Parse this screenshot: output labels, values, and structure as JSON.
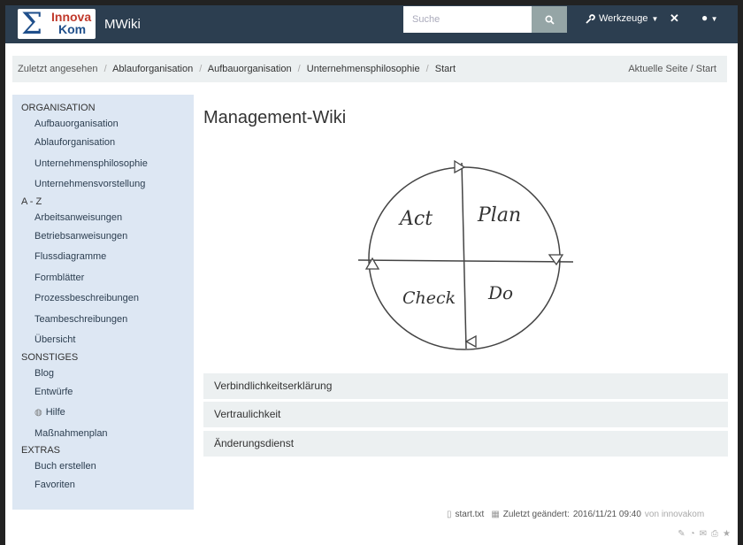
{
  "header": {
    "logo_line1": "Innova",
    "logo_line2": "Kom",
    "brand": "MWiki",
    "search_placeholder": "Suche",
    "tools_label": "Werkzeuge",
    "colors": {
      "topbar": "#2c3e50",
      "search_button": "#95a5a6"
    }
  },
  "breadcrumb": {
    "label": "Zuletzt angesehen",
    "items": [
      "Ablauforganisation",
      "Aufbauorganisation",
      "Unternehmensphilosophie",
      "Start"
    ],
    "current_label": "Aktuelle Seite / Start"
  },
  "sidebar": {
    "sections": [
      {
        "title": "ORGANISATION",
        "items": [
          "Aufbauorganisation",
          "Ablauforganisation",
          "Unternehmensphilosophie",
          "Unternehmensvorstellung"
        ]
      },
      {
        "title": "A - Z",
        "items": [
          "Arbeitsanweisungen",
          "Betriebsanweisungen",
          "Flussdiagramme",
          "Formblätter",
          "Prozessbeschreibungen",
          "Teambeschreibungen",
          "Übersicht"
        ]
      },
      {
        "title": "SONSTIGES",
        "items": [
          "Blog",
          "Entwürfe",
          "Hilfe",
          "Maßnahmenplan"
        ]
      },
      {
        "title": "EXTRAS",
        "items": [
          "Buch erstellen",
          "Favoriten"
        ]
      }
    ]
  },
  "main": {
    "title": "Management-Wiki",
    "diagram": {
      "quadrants": [
        "Act",
        "Plan",
        "Check",
        "Do"
      ]
    },
    "accordion": [
      "Verbindlichkeitserklärung",
      "Vertraulichkeit",
      "Änderungsdienst"
    ]
  },
  "footer": {
    "file": "start.txt",
    "modified_label": "Zuletzt geändert:",
    "modified_date": "2016/11/21 09:40",
    "by": "von innovakom"
  }
}
